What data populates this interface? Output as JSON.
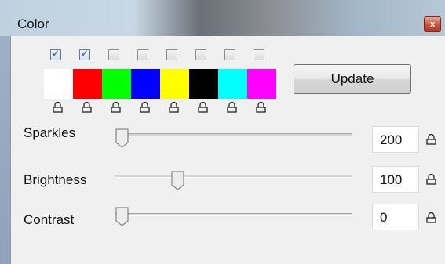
{
  "window": {
    "title": "Color",
    "close_glyph": "x"
  },
  "colors": {
    "swatches": [
      {
        "name": "white",
        "hex": "#ffffff",
        "checked": true
      },
      {
        "name": "red",
        "hex": "#ff0000",
        "checked": true
      },
      {
        "name": "green",
        "hex": "#00ff00",
        "checked": false
      },
      {
        "name": "blue",
        "hex": "#0000ff",
        "checked": false
      },
      {
        "name": "yellow",
        "hex": "#ffff00",
        "checked": false
      },
      {
        "name": "black",
        "hex": "#000000",
        "checked": false
      },
      {
        "name": "cyan",
        "hex": "#00ffff",
        "checked": false
      },
      {
        "name": "magenta",
        "hex": "#ff00ff",
        "checked": false
      }
    ],
    "lock_icon": "lock-icon"
  },
  "update_button": {
    "label": "Update"
  },
  "sliders": {
    "sparkles": {
      "label": "Sparkles",
      "value": "200",
      "level": 0.0
    },
    "brightness": {
      "label": "Brightness",
      "value": "100",
      "level": 0.25
    },
    "contrast": {
      "label": "Contrast",
      "value": "0",
      "level": 0.0
    }
  }
}
